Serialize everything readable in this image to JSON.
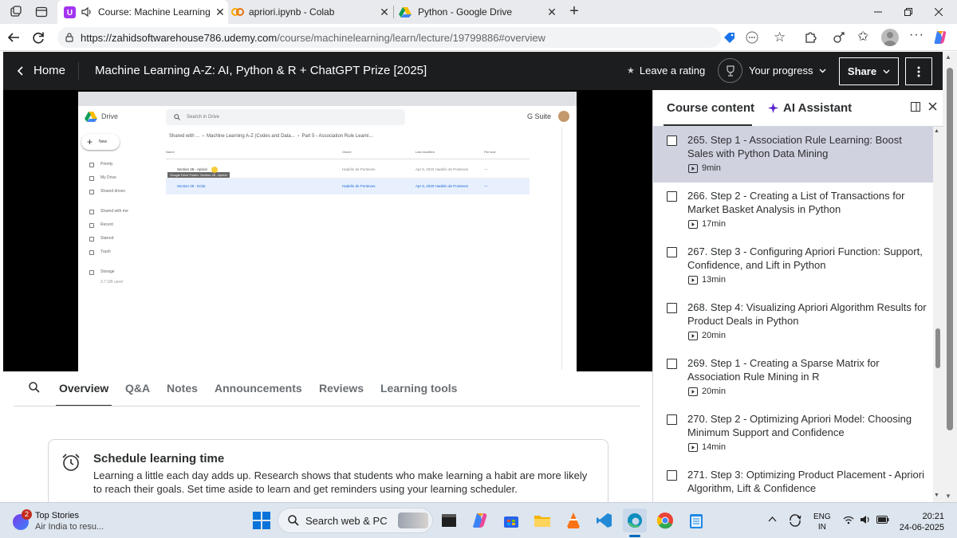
{
  "browser": {
    "tabs": [
      {
        "title": "Course: Machine Learning A-Z",
        "active": true,
        "icon": "udemy-icon"
      },
      {
        "title": "apriori.ipynb - Colab",
        "active": false,
        "icon": "colab-icon"
      },
      {
        "title": "Python - Google Drive",
        "active": false,
        "icon": "drive-icon"
      }
    ],
    "url_host": "https://zahidsoftwarehouse786.udemy.com",
    "url_path": "/course/machinelearning/learn/lecture/19799886#overview"
  },
  "header": {
    "home": "Home",
    "course_title": "Machine Learning A-Z: AI, Python & R + ChatGPT Prize [2025]",
    "leave_rating": "Leave a rating",
    "progress": "Your progress",
    "share": "Share"
  },
  "video": {
    "drive_title": "Drive",
    "search_placeholder": "Search in Drive",
    "gsuite": "G Suite",
    "new_btn": "New",
    "nav": [
      "Priority",
      "My Drive",
      "Shared drives",
      "Shared with me",
      "Recent",
      "Starred",
      "Trash",
      "Storage"
    ],
    "storage_used": "3.7 GB used",
    "breadcrumb": [
      "Shared with ...",
      "Machine Learning A-Z (Codes and Data...",
      "Part 5 - Association Rule Learni..."
    ],
    "columns": [
      "Name",
      "Owner",
      "Last modified",
      "File size"
    ],
    "rows": [
      {
        "name": "Section 28 - Apriori",
        "owner": "Hadelin de Ponteves",
        "modified": "Apr 8, 2020 Hadelin de Ponteves",
        "size": "—"
      },
      {
        "name": "Section 29 - Eclat",
        "owner": "Hadelin de Ponteves",
        "modified": "Apr 8, 2020 Hadelin de Ponteves",
        "size": "—"
      }
    ],
    "tooltip": "Google Drive Folder: Section 28 - Apriori"
  },
  "tabs": {
    "items": [
      "Overview",
      "Q&A",
      "Notes",
      "Announcements",
      "Reviews",
      "Learning tools"
    ],
    "active": "Overview"
  },
  "schedule": {
    "title": "Schedule learning time",
    "body": "Learning a little each day adds up. Research shows that students who make learning a habit are more likely to reach their goals. Set time aside to learn and get reminders using your learning scheduler."
  },
  "sidebar": {
    "tab_content": "Course content",
    "tab_ai": "AI Assistant",
    "lectures": [
      {
        "title": "265. Step 1 - Association Rule Learning: Boost Sales with Python Data Mining",
        "duration": "9min",
        "current": true
      },
      {
        "title": "266. Step 2 - Creating a List of Transactions for Market Basket Analysis in Python",
        "duration": "17min",
        "current": false
      },
      {
        "title": "267. Step 3 - Configuring Apriori Function: Support, Confidence, and Lift in Python",
        "duration": "13min",
        "current": false
      },
      {
        "title": "268. Step 4: Visualizing Apriori Algorithm Results for Product Deals in Python",
        "duration": "20min",
        "current": false
      },
      {
        "title": "269. Step 1 - Creating a Sparse Matrix for Association Rule Mining in R",
        "duration": "20min",
        "current": false
      },
      {
        "title": "270. Step 2 - Optimizing Apriori Model: Choosing Minimum Support and Confidence",
        "duration": "14min",
        "current": false
      },
      {
        "title": "271. Step 3: Optimizing Product Placement - Apriori Algorithm, Lift & Confidence",
        "duration": "",
        "current": false
      }
    ]
  },
  "taskbar": {
    "news_badge": "2",
    "news_title": "Top Stories",
    "news_sub": "Air India to resu...",
    "search": "Search web & PC",
    "lang1": "ENG",
    "lang2": "IN",
    "time": "20:21",
    "date": "24-06-2025"
  },
  "colors": {
    "udemy_dark": "#1c1d1f",
    "accent_purple": "#5624d0",
    "current_lecture": "#d1d2e0"
  }
}
